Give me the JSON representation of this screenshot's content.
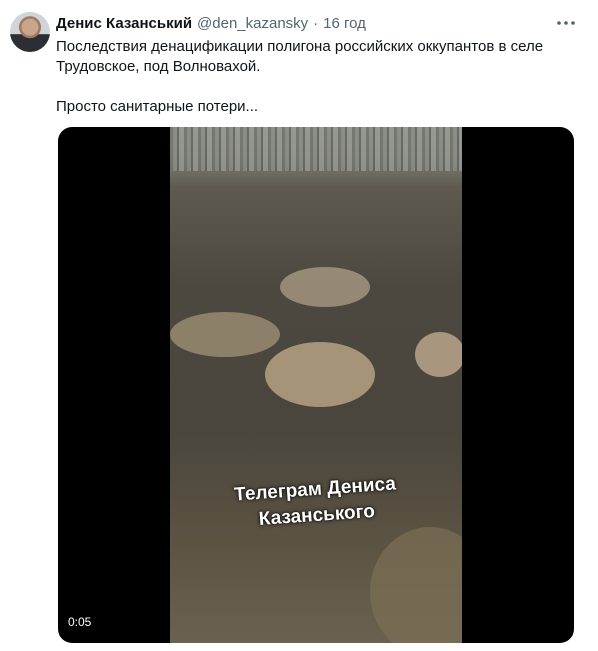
{
  "tweet": {
    "author_name": "Денис Казанський",
    "handle": "@den_kazansky",
    "separator": "·",
    "time": "16 год",
    "text_paragraphs": [
      "Последствия денацификации полигона российских оккупантов в селе Трудовское, под Волновахой.",
      "Просто санитарные потери..."
    ]
  },
  "media": {
    "overlay_caption_line1": "Телеграм Дениса",
    "overlay_caption_line2": "Казанського",
    "duration": "0:05"
  },
  "icons": {
    "more": "more-horizontal-icon"
  },
  "colors": {
    "text_primary": "#0f1419",
    "text_secondary": "#536471",
    "media_background": "#000000"
  }
}
